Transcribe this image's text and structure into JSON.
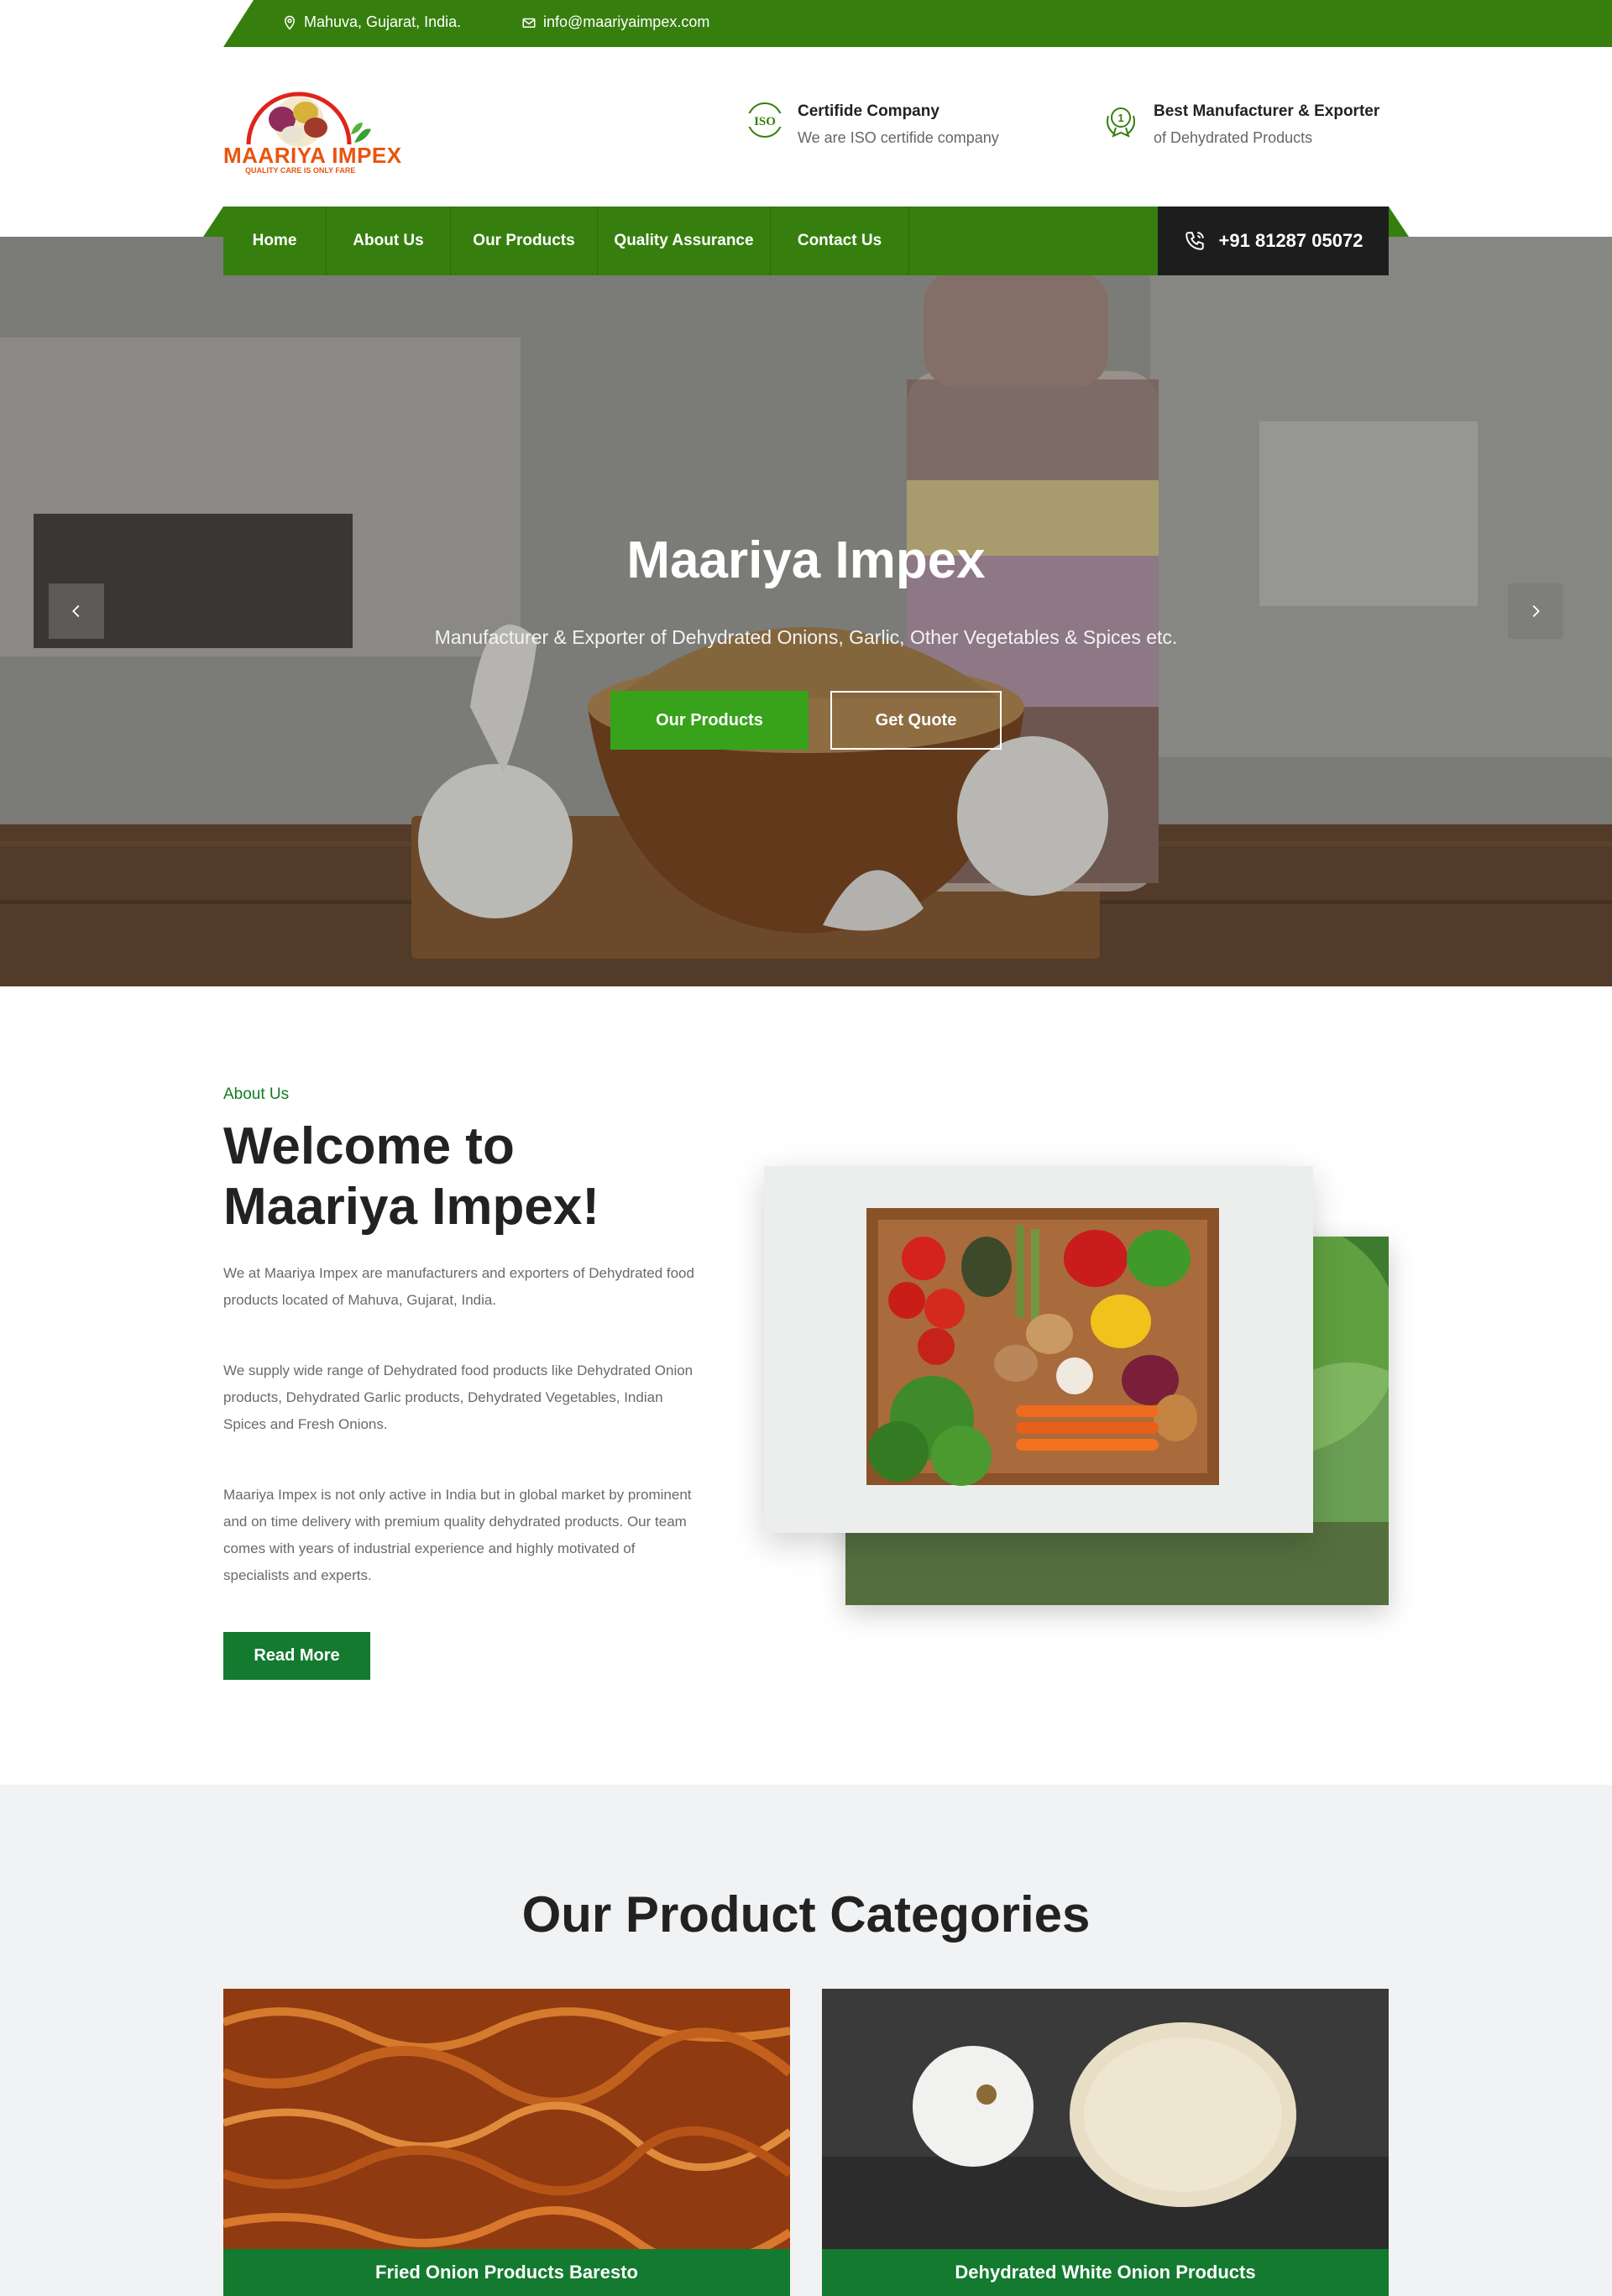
{
  "topbar": {
    "location": "Mahuva, Gujarat, India.",
    "email": "info@maariyaimpex.com"
  },
  "brand": {
    "name": "MAARIYA IMPEX",
    "tagline": "QUALITY CARE IS ONLY FARE"
  },
  "header_features": [
    {
      "icon": "iso-icon",
      "title": "Certifide Company",
      "subtitle": "We are ISO certifide company"
    },
    {
      "icon": "award-icon",
      "title": "Best Manufacturer & Exporter",
      "subtitle": "of Dehydrated Products"
    }
  ],
  "nav": {
    "items": [
      "Home",
      "About Us",
      "Our Products",
      "Quality Assurance",
      "Contact Us"
    ],
    "phone": "+91 81287 05072"
  },
  "hero": {
    "title": "Maariya Impex",
    "subtitle": "Manufacturer & Exporter of Dehydrated Onions, Garlic, Other Vegetables & Spices etc.",
    "primary_button": "Our Products",
    "secondary_button": "Get Quote",
    "prev_icon": "chevron-left-icon",
    "next_icon": "chevron-right-icon"
  },
  "about": {
    "tag": "About Us",
    "title": "Welcome to Maariya Impex!",
    "paragraphs": [
      "We at Maariya Impex are manufacturers and exporters of Dehydrated food products located of Mahuva, Gujarat, India.",
      "We supply wide range of Dehydrated food products like Dehydrated Onion products, Dehydrated Garlic products, Dehydrated Vegetables, Indian Spices and Fresh Onions.",
      "Maariya Impex is not only active in India but in global market by prominent and on time delivery with premium quality dehydrated products. Our team comes with years of industrial experience and highly motivated of specialists and experts."
    ],
    "button": "Read More"
  },
  "categories": {
    "heading": "Our Product Categories",
    "items": [
      "Fried Onion Products Baresto",
      "Dehydrated White Onion Products"
    ]
  },
  "colors": {
    "brand_green": "#367f0e",
    "accent_green": "#37a21a",
    "dark_green": "#137a2f",
    "dark": "#1d1d1d",
    "logo_orange": "#e8540f"
  }
}
